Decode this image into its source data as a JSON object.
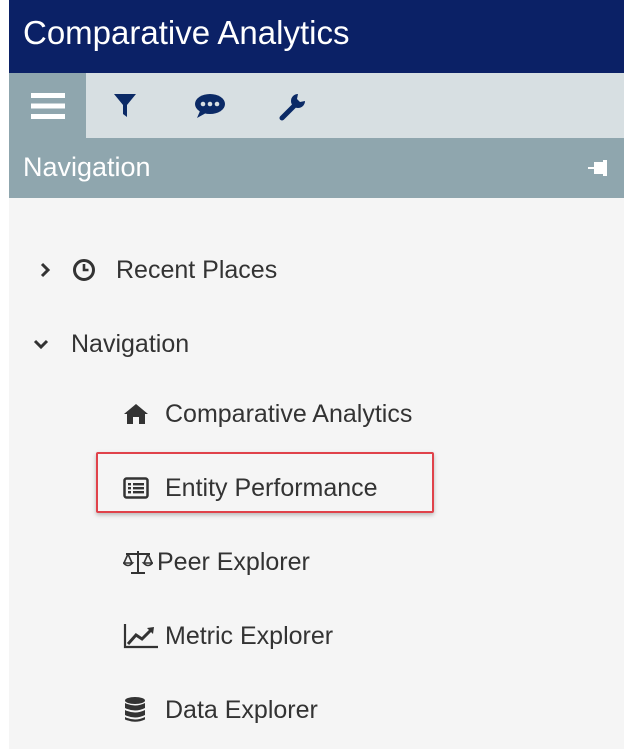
{
  "app": {
    "title": "Comparative Analytics"
  },
  "toolbar": {
    "tools": [
      {
        "icon": "hamburger-menu-icon",
        "active": true
      },
      {
        "icon": "filter-icon",
        "active": false
      },
      {
        "icon": "comment-icon",
        "active": false
      },
      {
        "icon": "wrench-icon",
        "active": false
      }
    ]
  },
  "panel": {
    "title": "Navigation",
    "pin_icon": "pin-icon"
  },
  "tree": {
    "recent": {
      "label": "Recent Places",
      "icon": "clock-icon",
      "expanded": false
    },
    "navigation": {
      "label": "Navigation",
      "expanded": true,
      "items": [
        {
          "label": "Comparative Analytics",
          "icon": "home-icon"
        },
        {
          "label": "Entity Performance",
          "icon": "list-card-icon",
          "highlighted": true
        },
        {
          "label": "Peer Explorer",
          "icon": "balance-scale-icon"
        },
        {
          "label": "Metric Explorer",
          "icon": "line-chart-icon"
        },
        {
          "label": "Data Explorer",
          "icon": "database-icon"
        }
      ]
    }
  },
  "colors": {
    "header_bg": "#0b2166",
    "toolbar_bg": "#d7dfe2",
    "panel_header_bg": "#8fa6ae",
    "body_bg": "#f5f5f5",
    "highlight_border": "#e0424a"
  }
}
